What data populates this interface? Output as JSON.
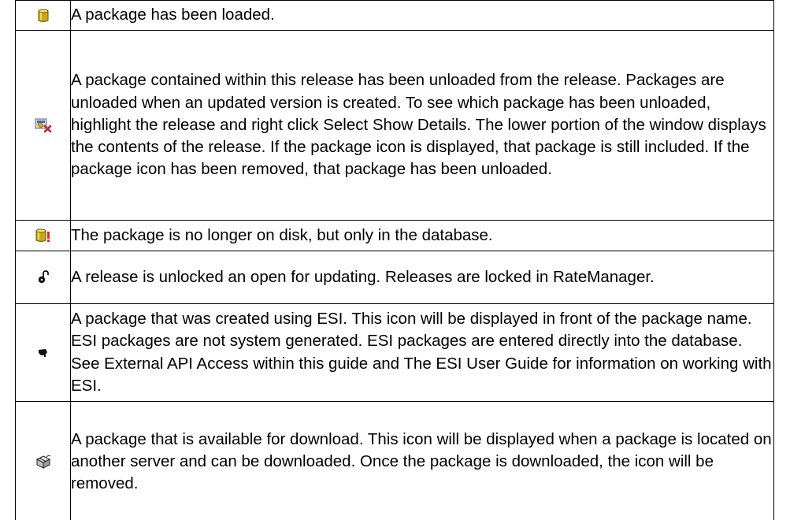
{
  "legend": {
    "rows": [
      {
        "icon": "package-loaded-icon",
        "description": "A package has been loaded."
      },
      {
        "icon": "package-unloaded-icon",
        "description": "A package contained within this release has been unloaded from the release. Packages are unloaded when an updated version is created. To see which package has been unloaded, highlight the release and right click Select Show Details. The lower portion of the window displays the contents of the release. If the package icon is displayed, that package is still included. If the package icon has been removed, that package has been unloaded."
      },
      {
        "icon": "package-database-only-icon",
        "description": "The package is no longer on disk, but only in the database."
      },
      {
        "icon": "unlocked-padlock-icon",
        "description": "A release is unlocked an open for updating. Releases are locked in RateManager."
      },
      {
        "icon": "esi-package-icon",
        "description": "A package that was created using ESI. This icon will be displayed in front of the package name. ESI packages are not system generated. ESI packages are entered directly into the database. See External API Access within this guide and The ESI User Guide for information on working with ESI."
      },
      {
        "icon": "package-download-icon",
        "description": "A package that is available for download. This icon will be displayed when a package is located on another server and can be downloaded. Once the package is downloaded, the icon will be removed."
      }
    ]
  }
}
